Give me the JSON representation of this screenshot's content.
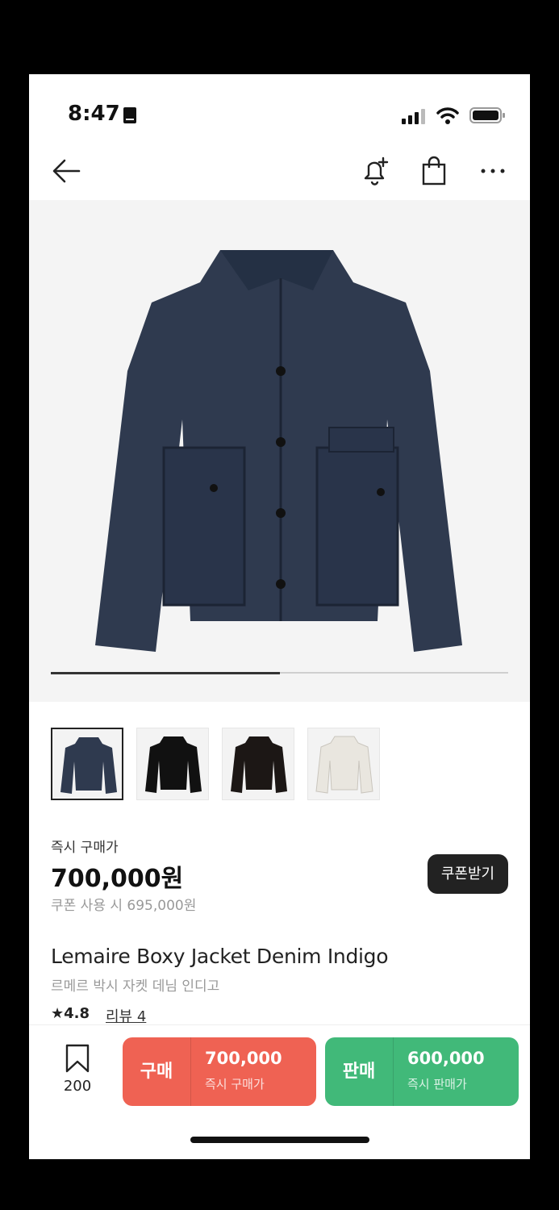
{
  "status": {
    "time": "8:47"
  },
  "product": {
    "price_label": "즉시 구매가",
    "price": "700,000원",
    "coupon_price": "쿠폰 사용 시 695,000원",
    "coupon_button": "쿠폰받기",
    "title": "Lemaire Boxy Jacket Denim Indigo",
    "subtitle": "르메르 박시 자켓 데님 인디고",
    "rating": "4.8",
    "review_label": "리뷰 4",
    "image_progress": 0.5,
    "thumbnails": [
      {
        "color": "#2f3a4f",
        "active": true
      },
      {
        "color": "#111111",
        "active": false
      },
      {
        "color": "#1c1715",
        "active": false
      },
      {
        "color": "#e9e6df",
        "active": false
      }
    ]
  },
  "bottom_bar": {
    "wish_count": "200",
    "buy": {
      "label": "구매",
      "amount": "700,000",
      "sub": "즉시 구매가"
    },
    "sell": {
      "label": "판매",
      "amount": "600,000",
      "sub": "즉시 판매가"
    }
  },
  "colors": {
    "buy": "#ef6253",
    "sell": "#41b979",
    "coupon_button": "#222222"
  },
  "icons": [
    "back-arrow-icon",
    "bell-plus-icon",
    "shopping-bag-icon",
    "more-icon",
    "bookmark-icon",
    "star-icon"
  ]
}
